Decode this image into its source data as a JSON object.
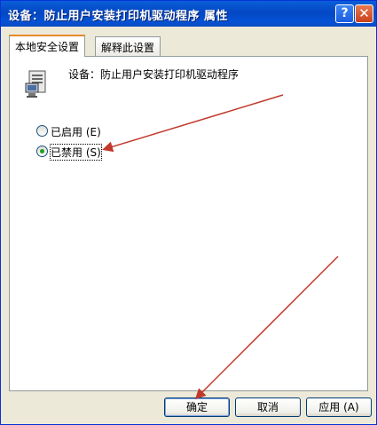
{
  "window": {
    "title": "设备：防止用户安装打印机驱动程序 属性",
    "help_symbol": "?",
    "close_symbol": "✕"
  },
  "tabs": [
    {
      "label": "本地安全设置",
      "active": true
    },
    {
      "label": "解释此设置",
      "active": false
    }
  ],
  "policy": {
    "label": "设备：防止用户安装打印机驱动程序",
    "icon": "computer-policy-icon"
  },
  "options": [
    {
      "label": "已启用 (E)",
      "selected": false
    },
    {
      "label": "已禁用 (S)",
      "selected": true
    }
  ],
  "buttons": {
    "ok": "确定",
    "cancel": "取消",
    "apply": "应用 (A)"
  },
  "annotations": {
    "arrow_color": "#c0392b"
  }
}
